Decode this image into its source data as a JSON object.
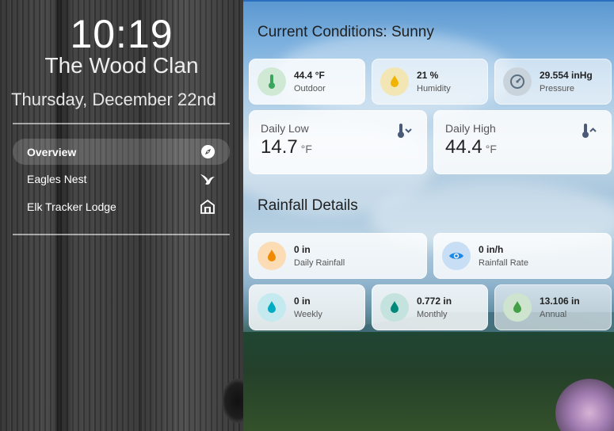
{
  "sidebar": {
    "time": "10:19",
    "title": "The Wood Clan",
    "date": "Thursday, December 22nd",
    "items": [
      {
        "label": "Overview",
        "icon": "compass-icon",
        "active": true
      },
      {
        "label": "Eagles Nest",
        "icon": "swift-bird-icon",
        "active": false
      },
      {
        "label": "Elk Tracker Lodge",
        "icon": "lodge-icon",
        "active": false
      }
    ]
  },
  "main": {
    "conditions_title": "Current Conditions: Sunny",
    "outdoor": {
      "value": "44.4 °F",
      "label": "Outdoor",
      "icon": "thermometer-icon",
      "color": "#3aa55d"
    },
    "humidity": {
      "value": "21 %",
      "label": "Humidity",
      "icon": "water-percent-icon",
      "color": "#f0b400"
    },
    "pressure": {
      "value": "29.554 inHg",
      "label": "Pressure",
      "icon": "gauge-icon",
      "color": "#5a6e80"
    },
    "daily_low": {
      "label": "Daily Low",
      "value": "14.7",
      "unit": "°F",
      "icon": "thermometer-chevron-down-icon"
    },
    "daily_high": {
      "label": "Daily High",
      "value": "44.4",
      "unit": "°F",
      "icon": "thermometer-chevron-up-icon"
    },
    "rainfall_title": "Rainfall Details",
    "daily_rainfall": {
      "value": "0 in",
      "label": "Daily Rainfall",
      "icon": "water-drop-icon",
      "color": "#f08a00"
    },
    "rainfall_rate": {
      "value": "0 in/h",
      "label": "Rainfall Rate",
      "icon": "eye-icon",
      "color": "#1e88e5"
    },
    "weekly": {
      "value": "0 in",
      "label": "Weekly",
      "icon": "water-drop-icon",
      "color": "#00acc1"
    },
    "monthly": {
      "value": "0.772 in",
      "label": "Monthly",
      "icon": "water-drop-icon",
      "color": "#00897b"
    },
    "annual": {
      "value": "13.106 in",
      "label": "Annual",
      "icon": "water-drop-icon",
      "color": "#43a047"
    }
  }
}
